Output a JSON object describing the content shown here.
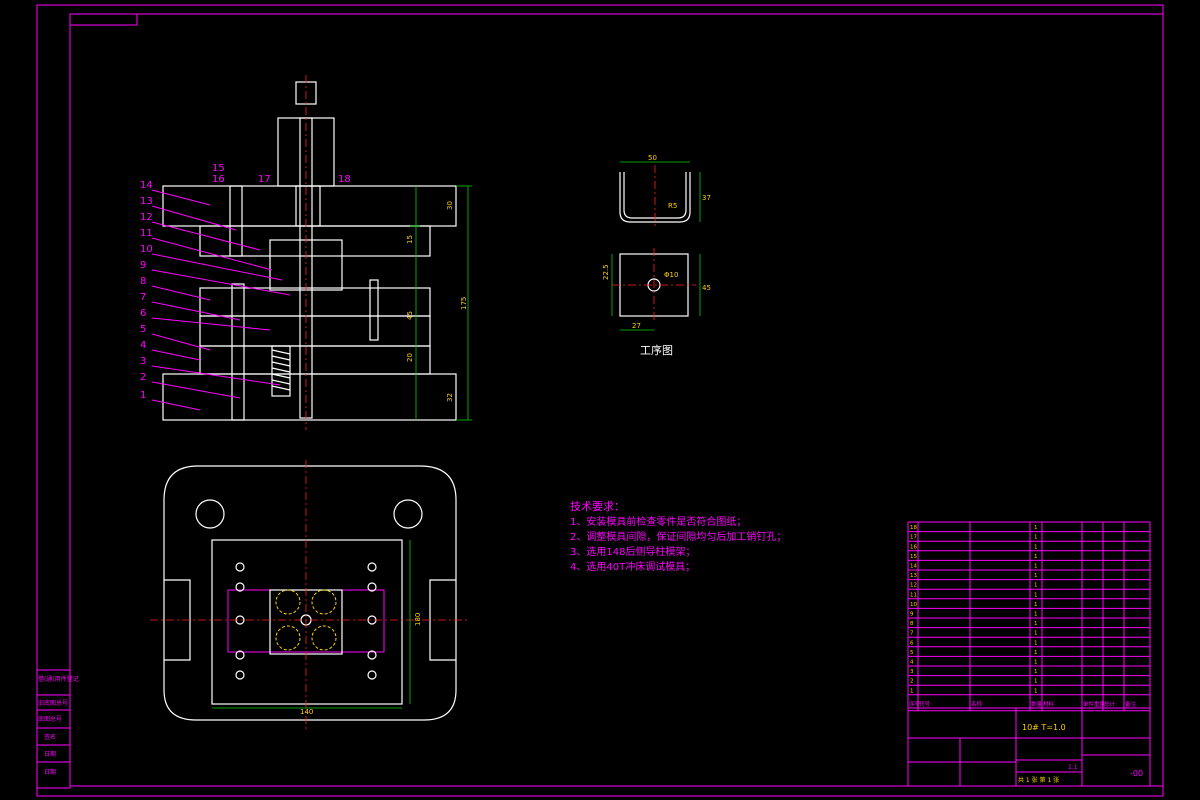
{
  "parts_labels": [
    "14",
    "13",
    "12",
    "11",
    "10",
    "9",
    "8",
    "7",
    "6",
    "5",
    "4",
    "3",
    "2",
    "1"
  ],
  "top_labels": [
    "15",
    "16",
    "17",
    "18"
  ],
  "dims_vertical_right": [
    "30",
    "15",
    "175",
    "45",
    "20",
    "32"
  ],
  "part_dims": {
    "width_top": "50",
    "height": "37",
    "radius": "R5",
    "hole": "Φ10",
    "length": "45",
    "width_bottom": "27",
    "side": "22.5"
  },
  "process_title": "工序图",
  "plan_dims": {
    "width": "140",
    "height": "180"
  },
  "tech_requirements": {
    "title": "技术要求：",
    "items": [
      "1、安装模具前检查零件是否符合图纸；",
      "2、调整模具间隙，保证间隙均匀后加工销钉孔；",
      "3、选用148后侧导柱模架；",
      "4、选用40T冲床调试模具；"
    ]
  },
  "bom_rows": [
    {
      "no": "18",
      "code": "",
      "name": "",
      "qty": "1",
      "mat": ""
    },
    {
      "no": "17",
      "code": "",
      "name": "",
      "qty": "1",
      "mat": ""
    },
    {
      "no": "16",
      "code": "",
      "name": "",
      "qty": "1",
      "mat": ""
    },
    {
      "no": "15",
      "code": "",
      "name": "",
      "qty": "1",
      "mat": ""
    },
    {
      "no": "14",
      "code": "",
      "name": "",
      "qty": "1",
      "mat": ""
    },
    {
      "no": "13",
      "code": "",
      "name": "",
      "qty": "1",
      "mat": ""
    },
    {
      "no": "12",
      "code": "",
      "name": "",
      "qty": "1",
      "mat": ""
    },
    {
      "no": "11",
      "code": "",
      "name": "",
      "qty": "1",
      "mat": ""
    },
    {
      "no": "10",
      "code": "",
      "name": "",
      "qty": "1",
      "mat": ""
    },
    {
      "no": "9",
      "code": "",
      "name": "",
      "qty": "1",
      "mat": ""
    },
    {
      "no": "8",
      "code": "",
      "name": "",
      "qty": "1",
      "mat": ""
    },
    {
      "no": "7",
      "code": "",
      "name": "",
      "qty": "1",
      "mat": ""
    },
    {
      "no": "6",
      "code": "",
      "name": "",
      "qty": "1",
      "mat": ""
    },
    {
      "no": "5",
      "code": "",
      "name": "",
      "qty": "1",
      "mat": ""
    },
    {
      "no": "4",
      "code": "",
      "name": "",
      "qty": "1",
      "mat": ""
    },
    {
      "no": "3",
      "code": "",
      "name": "",
      "qty": "1",
      "mat": ""
    },
    {
      "no": "2",
      "code": "",
      "name": "",
      "qty": "1",
      "mat": ""
    },
    {
      "no": "1",
      "code": "",
      "name": "",
      "qty": "1",
      "mat": ""
    }
  ],
  "bom_header": [
    "序号",
    "代号",
    "名称",
    "数量",
    "材料",
    "单件重量",
    "总计",
    "备注"
  ],
  "title_block": {
    "material": "10# T=1.0",
    "drawing_name": "",
    "scale": "1:1",
    "sheet": "共 1 张 第 1 张",
    "drawing_no": "-00"
  },
  "left_strip": [
    "借(通)用件登记",
    "旧底图总号",
    "底图总号",
    "签名",
    "日期",
    "日期"
  ],
  "colors": {
    "magenta": "#ff00ff",
    "white": "#ffffff",
    "red": "#ff2020",
    "yellow": "#ffd000",
    "green": "#00d000"
  }
}
